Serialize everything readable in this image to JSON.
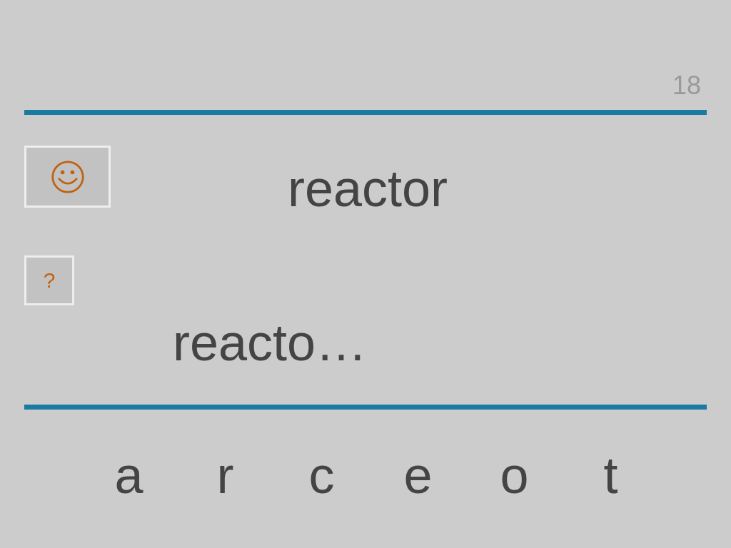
{
  "counter": "18",
  "buttons": [
    {
      "kind": "smiley"
    },
    {
      "kind": "hint",
      "label": "?"
    }
  ],
  "word": "reactor",
  "answer": "reacto…",
  "letters": [
    "a",
    "r",
    "c",
    "e",
    "o",
    "t"
  ]
}
